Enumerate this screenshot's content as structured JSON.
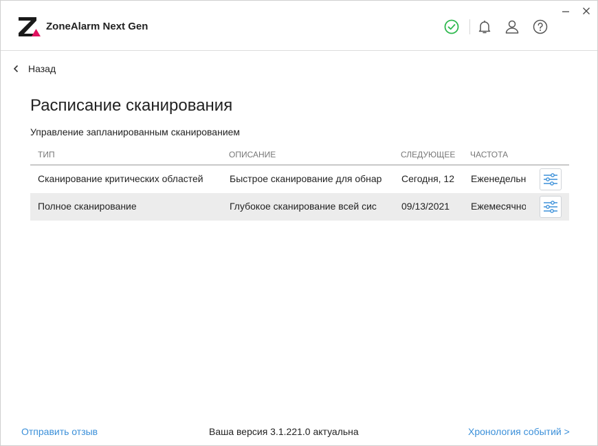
{
  "app": {
    "title": "ZoneAlarm Next Gen",
    "accent_color": "#e0115f",
    "status_color": "#2db84d",
    "link_color": "#3a8fd9"
  },
  "header": {
    "icons": [
      "check-circle-icon",
      "bell-icon",
      "user-icon",
      "help-icon"
    ],
    "window_controls": [
      "minimize-icon",
      "close-icon"
    ]
  },
  "nav": {
    "back_label": "Назад"
  },
  "page": {
    "title": "Расписание сканирования",
    "subtitle": "Управление запланированным сканированием"
  },
  "table": {
    "columns": [
      "ТИП",
      "ОПИСАНИЕ",
      "СЛЕДУЮЩЕЕ С",
      "ЧАСТОТА"
    ],
    "rows": [
      {
        "type": "Сканирование критических областей",
        "description": "Быстрое сканирование для обнар",
        "next": "Сегодня, 12",
        "frequency": "Еженедельн"
      },
      {
        "type": "Полное сканирование",
        "description": "Глубокое сканирование всей сис",
        "next": "09/13/2021",
        "frequency": "Ежемесячно"
      }
    ]
  },
  "footer": {
    "feedback_link": "Отправить отзыв",
    "version_text": "Ваша версия 3.1.221.0 актуальна",
    "history_link": "Хронология событий >"
  }
}
